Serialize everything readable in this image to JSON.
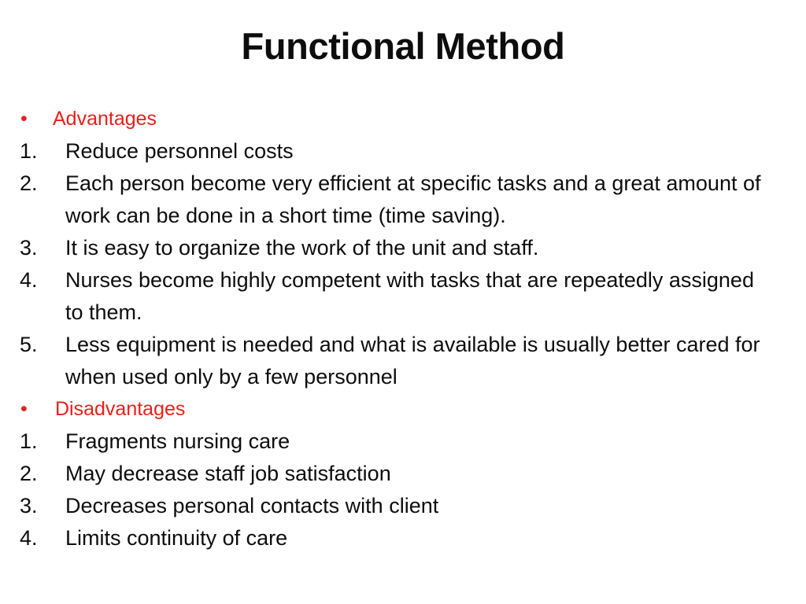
{
  "slide": {
    "title": "Functional Method",
    "background_color": "#ffffff",
    "title_color": "#0d0d0d",
    "heading_color": "#e8201a",
    "body_color": "#0d0d0d",
    "bullet_glyph": "•",
    "sections": [
      {
        "heading": "Advantages",
        "heading_marker": "•",
        "items": [
          {
            "marker": "1.",
            "text": "Reduce personnel costs"
          },
          {
            "marker": "2.",
            "text": "Each person become very efficient at specific tasks and a great amount of work can be done in a short time (time saving)."
          },
          {
            "marker": "3.",
            "text": "It is easy to organize the work of the unit and staff."
          },
          {
            "marker": "4.",
            "text": "Nurses become highly competent with tasks that are repeatedly assigned to them."
          },
          {
            "marker": "5.",
            "text": "Less equipment is needed and what is available is usually better cared for when used only by a few personnel"
          }
        ]
      },
      {
        "heading": "Disadvantages",
        "heading_marker": "•",
        "items": [
          {
            "marker": "1.",
            "text": "Fragments nursing care"
          },
          {
            "marker": "2.",
            "text": "May decrease staff job satisfaction"
          },
          {
            "marker": "3.",
            "text": "Decreases personal contacts with client"
          },
          {
            "marker": "4.",
            "text": "Limits continuity of care"
          }
        ]
      }
    ]
  }
}
